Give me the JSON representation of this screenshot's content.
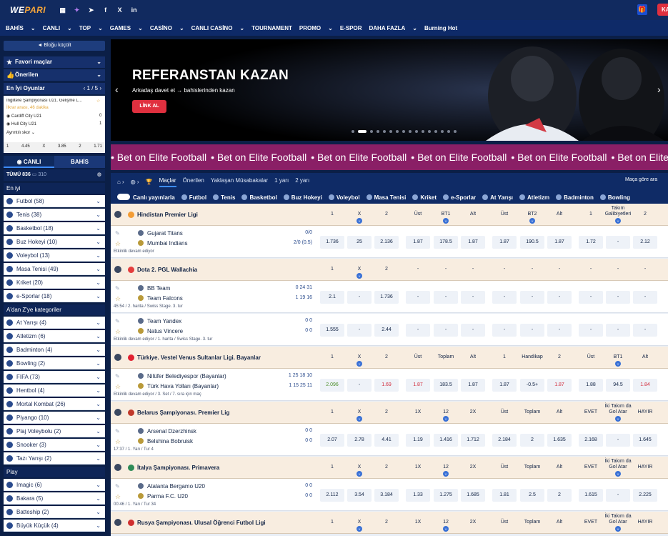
{
  "top": {
    "logo": "WE",
    "logo2": "PARI",
    "kay": "KAY"
  },
  "nav": [
    "BAHİS",
    "CANLI",
    "TOP",
    "GAMES",
    "CASİNO",
    "CANLI CASİNO",
    "TOURNAMENT",
    "PROMO",
    "E-SPOR",
    "DAHA FAZLA",
    "Burning Hot"
  ],
  "sidebar": {
    "collapse": "◄ Bloğu küçült",
    "fav": "Favori maçlar",
    "featured": "Önerilen",
    "best": "En İyi Oyunlar",
    "best_page": "1 / 5",
    "card": {
      "league": "İngiltere Şampiyonası U21. Gelişme L...",
      "status": "İlkrar anası, 46 dakika",
      "team1": "Cardiff City U21",
      "score1": "0",
      "team2": "Hull City U21",
      "score2": "1",
      "more": "Ayrıntılı skor",
      "o1": "1",
      "o1v": "4.45",
      "o2": "X",
      "o2v": "3.85",
      "o3": "2",
      "o3v": "1.71"
    },
    "tab_live": "CANLI",
    "tab_bet": "BAHİS",
    "all": "TÜMÜ 836",
    "all_count": "310",
    "top_section": "En iyi",
    "sports_top": [
      {
        "name": "Futbol (58)"
      },
      {
        "name": "Tenis (38)"
      },
      {
        "name": "Basketbol (18)"
      },
      {
        "name": "Buz Hokeyi (10)"
      },
      {
        "name": "Voleybol (13)"
      },
      {
        "name": "Masa Tenisi (49)"
      },
      {
        "name": "Kriket (20)"
      },
      {
        "name": "e-Sporlar (18)"
      }
    ],
    "az_section": "A'dan Z'ye kategoriler",
    "sports_az": [
      {
        "name": "At Yarışı (4)"
      },
      {
        "name": "Atletizm (6)"
      },
      {
        "name": "Badminton (4)"
      },
      {
        "name": "Bowling (2)"
      },
      {
        "name": "FIFA (73)"
      },
      {
        "name": "Hentbol (4)"
      },
      {
        "name": "Mortal Kombat (26)"
      },
      {
        "name": "Piyango (10)"
      },
      {
        "name": "Plaj Voleybolu (2)"
      },
      {
        "name": "Snooker (3)"
      },
      {
        "name": "Tazı Yarışı (2)"
      }
    ],
    "play_section": "Play",
    "sports_play": [
      {
        "name": "Imagic (6)"
      },
      {
        "name": "Bakara (5)"
      },
      {
        "name": "Batteship (2)"
      },
      {
        "name": "Büyük Küçük (4)"
      }
    ]
  },
  "banner": {
    "title": "REFERANSTAN KAZAN",
    "subtitle": "Arkadaş davet et → bahislerinden kazan",
    "button": "LİNK AL",
    "slides": 16,
    "active": 1
  },
  "marquee": [
    "Bet on Elite Football",
    "Bet on Elite Football",
    "Bet on Elite Football",
    "Bet on Elite Football",
    "Bet on Elite Football",
    "Bet on Elite Football"
  ],
  "odds": {
    "tabs": [
      "Maçlar",
      "Önerilen",
      "Yaklaşan Müsabakalar",
      "1 yarı",
      "2 yarı"
    ],
    "sort": "Maça göre ara",
    "live_toggle": "Canlı yayınlarla",
    "sports": [
      "Futbol",
      "Tenis",
      "Basketbol",
      "Buz Hokeyi",
      "Voleybol",
      "Masa Tenisi",
      "Kriket",
      "e-Sporlar",
      "At Yarışı",
      "Atletizm",
      "Badminton",
      "Bowling"
    ],
    "leagues": [
      {
        "name": "Hindistan Premier Ligi",
        "headers": [
          "1",
          "X",
          "2",
          "Üst",
          "BT1",
          "Alt",
          "Üst",
          "BT2",
          "Alt",
          "1",
          "Takım Galibiyetleri",
          "2"
        ],
        "events": [
          {
            "t1": "Gujarat Titans",
            "t2": "Mumbai Indians",
            "s1": "0/0",
            "s2": "2/0 (0.5)",
            "info": "Etkinlik devam ediyor",
            "odds": [
              "1.736",
              "25",
              "2.136",
              "1.87",
              "178.5",
              "1.87",
              "1.87",
              "190.5",
              "1.87",
              "1.72",
              "-",
              "2.12"
            ]
          }
        ]
      },
      {
        "name": "Dota 2. PGL Wallachia",
        "headers": [
          "1",
          "X",
          "2",
          "-",
          "-",
          "-",
          "-",
          "-",
          "-",
          "-",
          "-",
          "-"
        ],
        "events": [
          {
            "t1": "BB Team",
            "t2": "Team Falcons",
            "s1": "0  24  31",
            "s2": "1  19  16",
            "info": "45:54 / 2. harita / Swiss Stage. 3. tur",
            "odds": [
              "2.1",
              "-",
              "1.736",
              "-",
              "-",
              "-",
              "-",
              "-",
              "-",
              "-",
              "-",
              "-"
            ]
          },
          {
            "t1": "Team Yandex",
            "t2": "Natus Vincere",
            "s1": "0  0",
            "s2": "0  0",
            "info": "Etkinlik devam ediyor / 1. harita / Swiss Stage. 3. tur",
            "odds": [
              "1.555",
              "-",
              "2.44",
              "-",
              "-",
              "-",
              "-",
              "-",
              "-",
              "-",
              "-",
              "-"
            ]
          }
        ]
      },
      {
        "name": "Türkiye. Vestel Venus Sultanlar Ligi. Bayanlar",
        "headers": [
          "1",
          "X",
          "2",
          "Üst",
          "Toplam",
          "Alt",
          "1",
          "Handikap",
          "2",
          "Üst",
          "BT1",
          "Alt"
        ],
        "events": [
          {
            "t1": "Nilüfer Belediyespor (Bayanlar)",
            "t2": "Türk Hava Yolları (Bayanlar)",
            "s1": "1  25  18  10",
            "s2": "1  15  25  11",
            "info": "Etkinlik devam ediyor / 3. Set / 7. sıra için maç",
            "odds": [
              "2.096",
              "-",
              "1.69",
              "1.87",
              "183.5",
              "1.87",
              "1.87",
              "-0.5+",
              "1.87",
              "1.88",
              "94.5",
              "1.84"
            ]
          }
        ]
      },
      {
        "name": "Belarus Şampiyonası. Premier Lig",
        "headers": [
          "1",
          "X",
          "2",
          "1X",
          "12",
          "2X",
          "Üst",
          "Toplam",
          "Alt",
          "EVET",
          "İki Takım da Gol Atar",
          "HAYIR"
        ],
        "events": [
          {
            "t1": "Arsenal Dzerzhinsk",
            "t2": "Belshina Bobruisk",
            "s1": "0  0",
            "s2": "0  0",
            "info": "17:37 / 1. Yarı / Tur 4",
            "odds": [
              "2.07",
              "2.78",
              "4.41",
              "1.19",
              "1.416",
              "1.712",
              "2.184",
              "2",
              "1.635",
              "2.168",
              "-",
              "1.645"
            ]
          }
        ]
      },
      {
        "name": "İtalya Şampiyonası. Primavera",
        "headers": [
          "1",
          "X",
          "2",
          "1X",
          "12",
          "2X",
          "Üst",
          "Toplam",
          "Alt",
          "EVET",
          "İki Takım da Gol Atar",
          "HAYIR"
        ],
        "events": [
          {
            "t1": "Atalanta Bergamo U20",
            "t2": "Parma F.C. U20",
            "s1": "0  0",
            "s2": "0  0",
            "info": "00:46 / 1. Yarı / Tur 34",
            "odds": [
              "2.112",
              "3.54",
              "3.184",
              "1.33",
              "1.275",
              "1.685",
              "1.81",
              "2.5",
              "2",
              "1.615",
              "-",
              "2.225"
            ]
          }
        ]
      },
      {
        "name": "Rusya Şampiyonası. Ulusal Öğrenci Futbol Ligi",
        "headers": [
          "1",
          "X",
          "2",
          "1X",
          "12",
          "2X",
          "Üst",
          "Toplam",
          "Alt",
          "EVET",
          "İki Takım da Gol Atar",
          "HAYIR"
        ],
        "events": []
      }
    ]
  }
}
